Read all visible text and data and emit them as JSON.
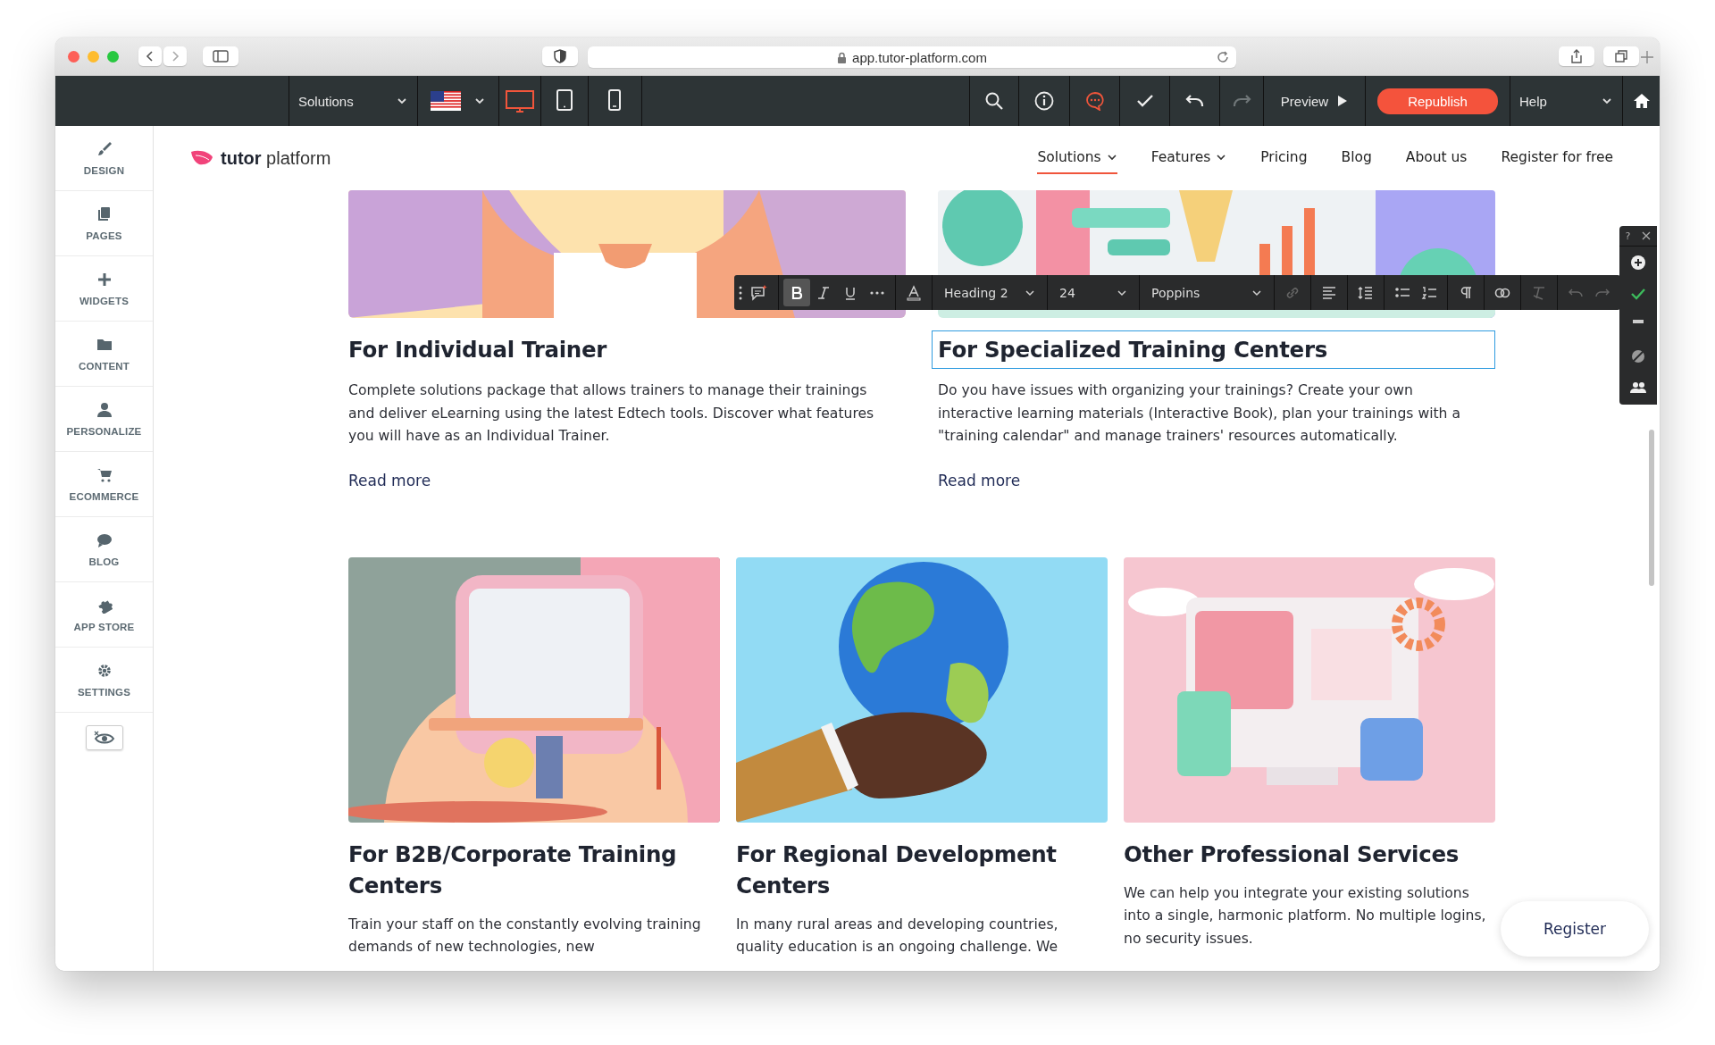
{
  "browser": {
    "url": "app.tutor-platform.com"
  },
  "editor_toolbar": {
    "page_select": "Solutions",
    "devices": [
      {
        "selected": true
      },
      {
        "selected": false
      },
      {
        "selected": false
      }
    ],
    "tools": [
      {
        "disabled": false
      },
      {
        "disabled": false
      },
      {
        "disabled": false
      },
      {
        "disabled": false
      },
      {
        "disabled": false
      },
      {
        "disabled": true
      }
    ],
    "preview": "Preview",
    "publish": "Republish",
    "help": "Help"
  },
  "sidebar": {
    "items": [
      {
        "label": "DESIGN"
      },
      {
        "label": "PAGES"
      },
      {
        "label": "WIDGETS"
      },
      {
        "label": "CONTENT"
      },
      {
        "label": "PERSONALIZE"
      },
      {
        "label": "ECOMMERCE"
      },
      {
        "label": "BLOG"
      },
      {
        "label": "APP STORE"
      },
      {
        "label": "SETTINGS"
      }
    ]
  },
  "site": {
    "logo": {
      "bold": "tutor",
      "light": "platform"
    },
    "nav": [
      {
        "label": "Solutions",
        "selected": true,
        "has_menu": true
      },
      {
        "label": "Features",
        "selected": false,
        "has_menu": true
      },
      {
        "label": "Pricing",
        "selected": false,
        "has_menu": false
      },
      {
        "label": "Blog",
        "selected": false,
        "has_menu": false
      },
      {
        "label": "About us",
        "selected": false,
        "has_menu": false
      },
      {
        "label": "Register for free",
        "selected": false,
        "has_menu": false
      }
    ]
  },
  "text_toolbar": {
    "bold": true,
    "block_style": "Heading 2",
    "font_size": "24",
    "font": "Poppins"
  },
  "float_panel": {
    "help": "?"
  },
  "cards": [
    {
      "title": "For Individual Trainer",
      "body": "Complete solutions package that allows trainers to manage their trainings and deliver eLearning using the latest Edtech tools. Discover what features you will have as an Individual Trainer.",
      "link": "Read more",
      "editing": false
    },
    {
      "title": "For Specialized Training Centers",
      "body": "Do you have issues with organizing your trainings? Create your own interactive learning materials (Interactive Book), plan your trainings with a \"training calendar\" and manage trainers' resources automatically.",
      "link": "Read more",
      "editing": true
    }
  ],
  "cards_row2": [
    {
      "title": "For B2B/Corporate Training Centers",
      "body": "Train your staff on the constantly evolving training demands of new technologies, new"
    },
    {
      "title": "For Regional Development Centers",
      "body": "In many rural areas and developing countries, quality education is an ongoing challenge. We"
    },
    {
      "title": "Other Professional Services",
      "body": "We can help you integrate your existing solutions into a single, harmonic platform. No multiple logins, no security issues."
    }
  ],
  "register_button": "Register"
}
